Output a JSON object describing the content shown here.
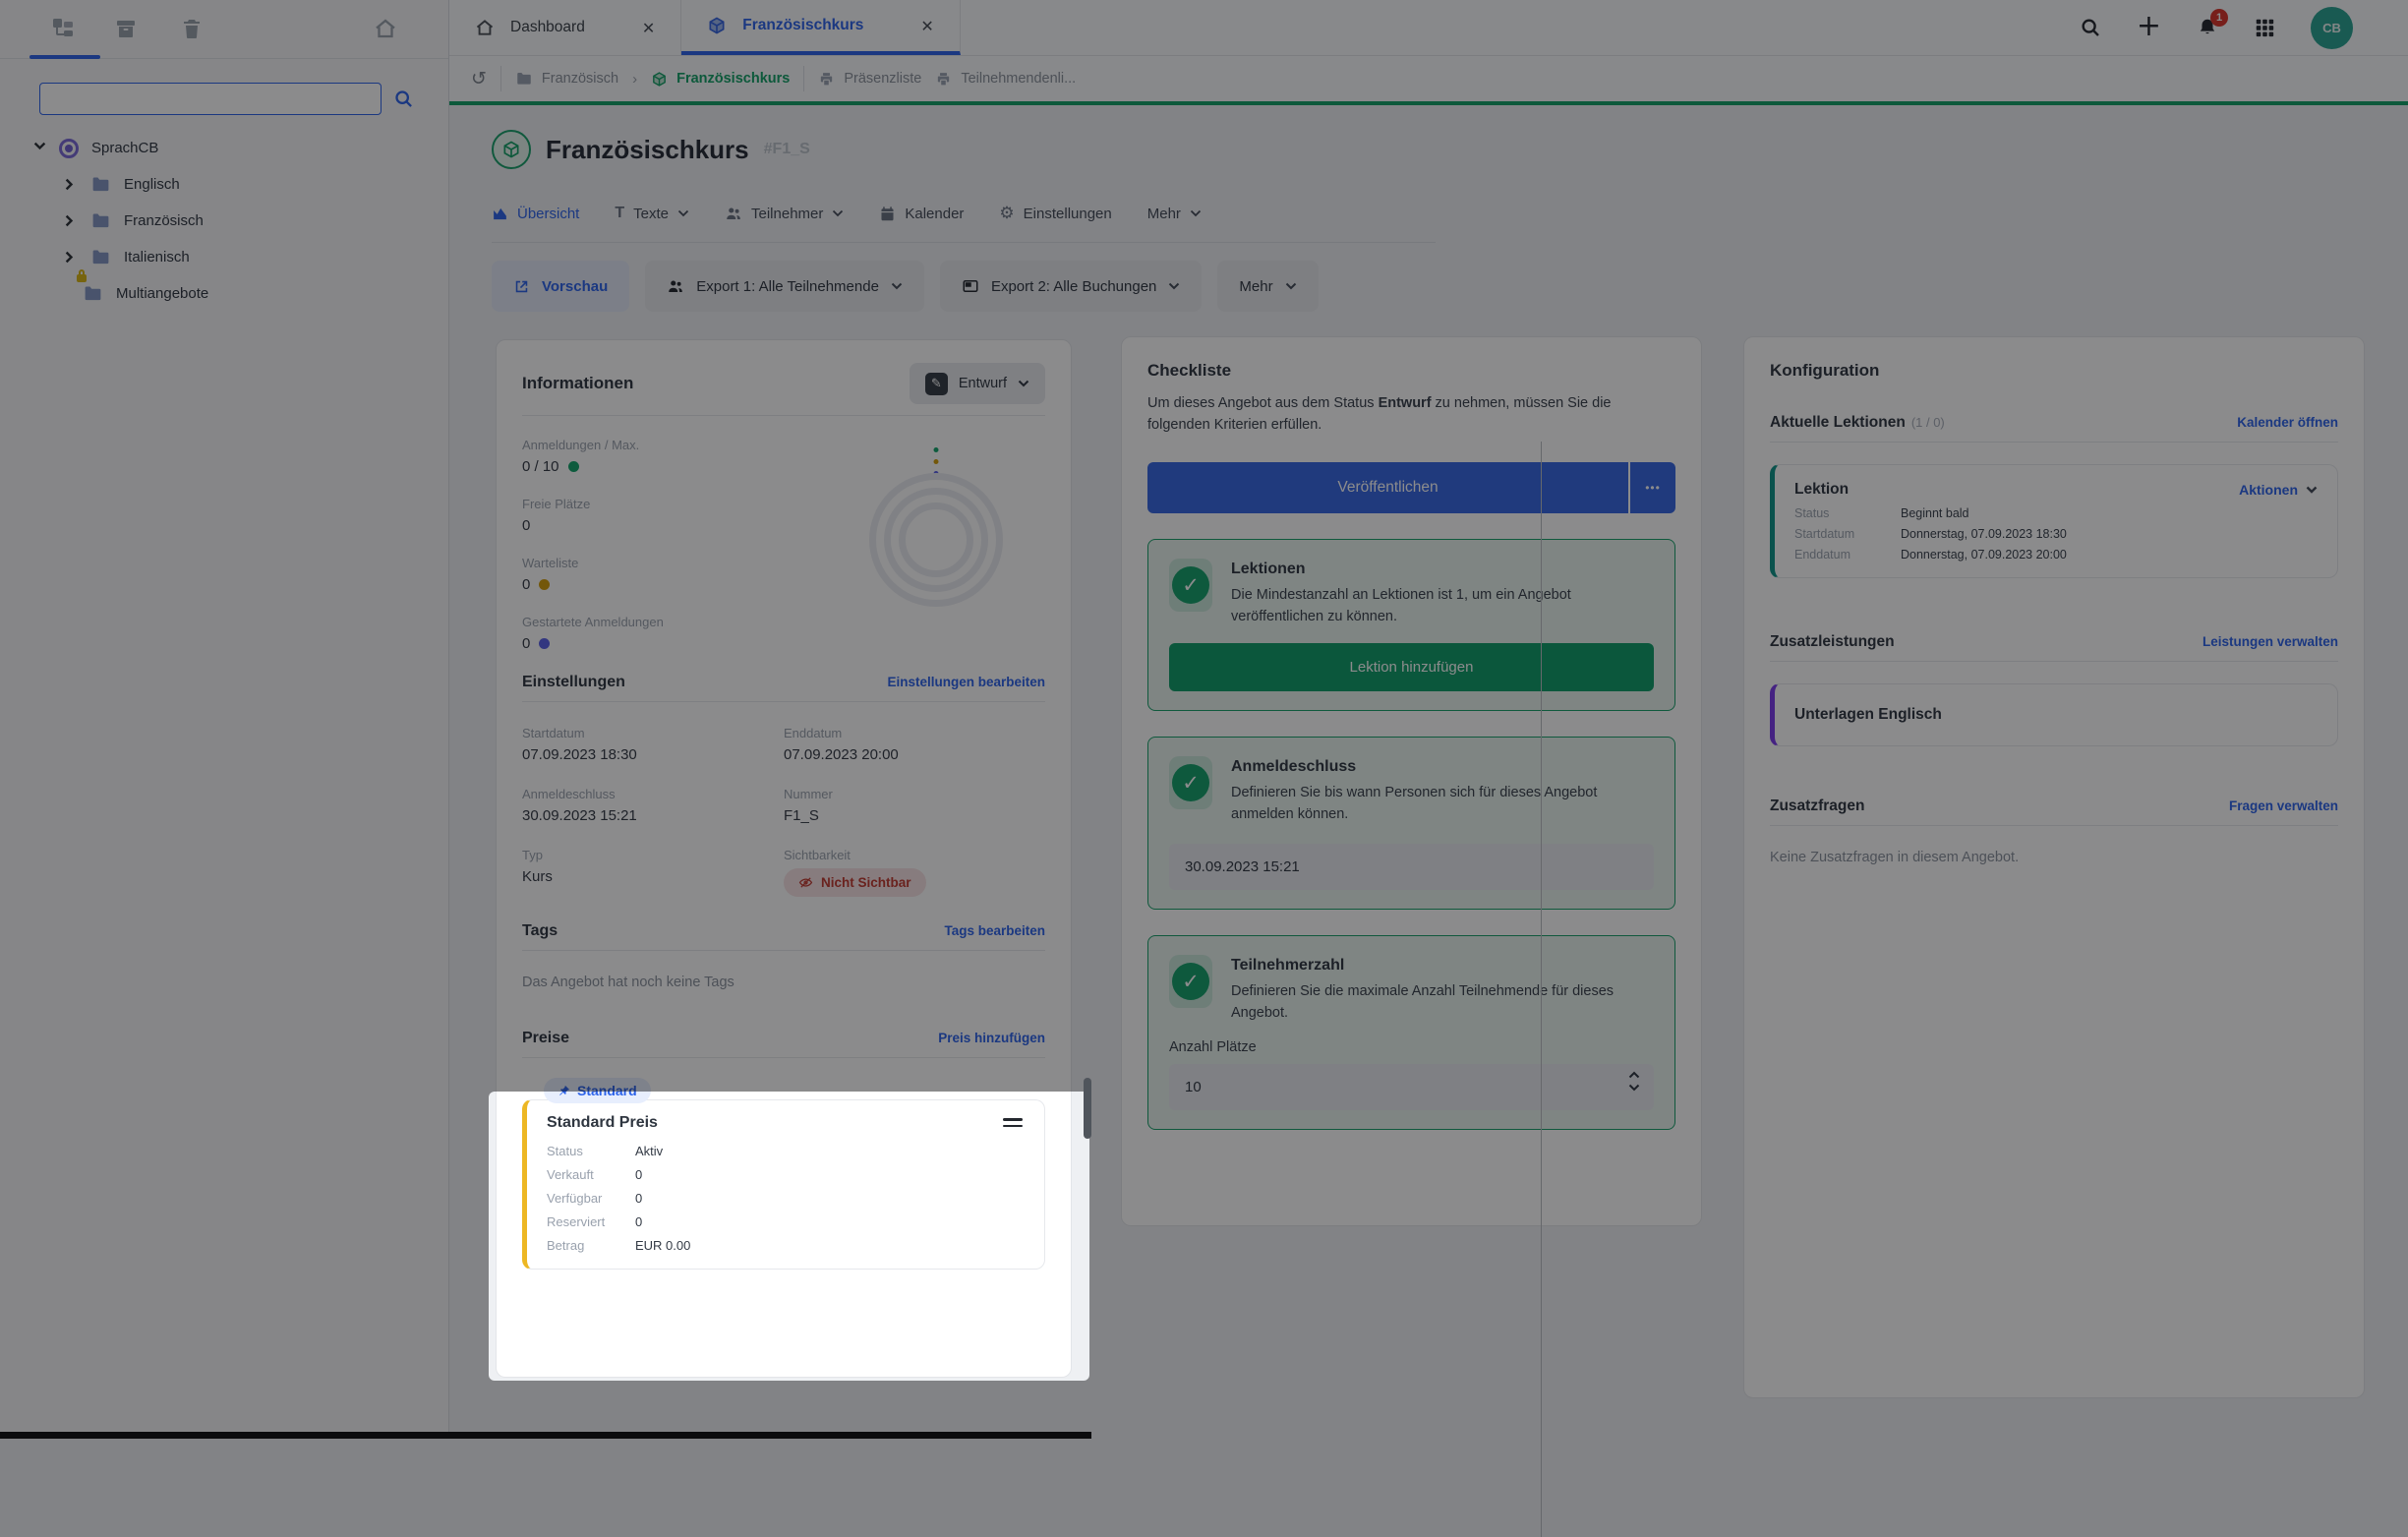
{
  "colors": {
    "accent_blue": "#2c63ea",
    "green": "#12a066",
    "publish_blue": "#3566e3",
    "button_green": "#0f9d68",
    "amber_dot": "#d19e0b",
    "indigo_dot": "#5a60e8",
    "price_yellow": "#edb723",
    "teal_accent": "#0d9488",
    "purple_accent": "#7c3aed",
    "error_red": "#c13a30",
    "notification_red": "#d9342b",
    "avatar_teal": "#28a391"
  },
  "icons": {
    "close": "✕",
    "gear": "⚙",
    "history": "↺",
    "check": "✓",
    "dots": "•••",
    "plus": "+",
    "pencil": "✎",
    "texte": "T"
  },
  "sidebar": {
    "search": {
      "value": ""
    },
    "tree": [
      {
        "label": "SprachCB"
      },
      {
        "label": "Englisch"
      },
      {
        "label": "Französisch"
      },
      {
        "label": "Italienisch"
      },
      {
        "label": "Multiangebote"
      }
    ]
  },
  "tabs": {
    "dashboard": "Dashboard",
    "offer": "Französischkurs"
  },
  "topbar": {
    "notification_count": "1",
    "avatar": "CB"
  },
  "breadcrumb": {
    "folder": "Französisch",
    "offer": "Französischkurs",
    "print1": "Präsenzliste",
    "print2": "Teilnehmendenli..."
  },
  "page": {
    "title": "Französischkurs",
    "number_tag": "#F1_S",
    "nav": {
      "uebersicht": "Übersicht",
      "texte": "Texte",
      "teilnehmer": "Teilnehmer",
      "kalender": "Kalender",
      "einstellungen": "Einstellungen",
      "mehr": "Mehr"
    },
    "actions": {
      "vorschau": "Vorschau",
      "export1": "Export 1: Alle Teilnehmende",
      "export2": "Export 2: Alle Buchungen",
      "mehr": "Mehr"
    }
  },
  "info": {
    "title": "Informationen",
    "status_button": "Entwurf",
    "stats": [
      {
        "label": "Anmeldungen / Max.",
        "value": "0 / 10"
      },
      {
        "label": "Freie Plätze",
        "value": "0"
      },
      {
        "label": "Warteliste",
        "value": "0"
      },
      {
        "label": "Gestartete Anmeldungen",
        "value": "0"
      }
    ],
    "settings": {
      "title": "Einstellungen",
      "edit_link": "Einstellungen bearbeiten",
      "fields": [
        {
          "label": "Startdatum",
          "value": "07.09.2023 18:30"
        },
        {
          "label": "Enddatum",
          "value": "07.09.2023 20:00"
        },
        {
          "label": "Anmeldeschluss",
          "value": "30.09.2023 15:21"
        },
        {
          "label": "Nummer",
          "value": "F1_S"
        },
        {
          "label": "Typ",
          "value": "Kurs"
        },
        {
          "label": "Sichtbarkeit",
          "value": "Nicht Sichtbar"
        }
      ]
    },
    "tags": {
      "title": "Tags",
      "edit_link": "Tags bearbeiten",
      "empty": "Das Angebot hat noch keine Tags"
    },
    "preise": {
      "title": "Preise",
      "add_link": "Preis hinzufügen",
      "badge": "Standard",
      "card": {
        "title": "Standard Preis",
        "rows": [
          {
            "label": "Status",
            "value": "Aktiv"
          },
          {
            "label": "Verkauft",
            "value": "0"
          },
          {
            "label": "Verfügbar",
            "value": "0"
          },
          {
            "label": "Reserviert",
            "value": "0"
          },
          {
            "label": "Betrag",
            "value": "EUR 0.00"
          }
        ]
      }
    }
  },
  "checkliste": {
    "title": "Checkliste",
    "intro_1": "Um dieses Angebot aus dem Status ",
    "intro_bold": "Entwurf",
    "intro_2": " zu nehmen, müssen Sie die folgenden Kriterien erfüllen.",
    "publish": "Veröffentlichen",
    "items": [
      {
        "title": "Lektionen",
        "desc": "Die Mindestanzahl an Lektionen ist 1, um ein Angebot veröffentlichen zu können.",
        "button": "Lektion hinzufügen"
      },
      {
        "title": "Anmeldeschluss",
        "desc": "Definieren Sie bis wann Personen sich für dieses Angebot anmelden können.",
        "input": "30.09.2023 15:21"
      },
      {
        "title": "Teilnehmerzahl",
        "desc": "Definieren Sie die maximale Anzahl Teilnehmende für dieses Angebot.",
        "input_label": "Anzahl Plätze",
        "input": "10"
      }
    ]
  },
  "konfiguration": {
    "title": "Konfiguration",
    "lektionen": {
      "title": "Aktuelle Lektionen",
      "count": "(1 / 0)",
      "link": "Kalender öffnen",
      "card": {
        "title": "Lektion",
        "menu": "Aktionen",
        "rows": [
          {
            "label": "Status",
            "value": "Beginnt bald"
          },
          {
            "label": "Startdatum",
            "value": "Donnerstag, 07.09.2023 18:30"
          },
          {
            "label": "Enddatum",
            "value": "Donnerstag, 07.09.2023 20:00"
          }
        ]
      }
    },
    "zusatzleistungen": {
      "title": "Zusatzleistungen",
      "link": "Leistungen verwalten",
      "item": "Unterlagen Englisch"
    },
    "zusatzfragen": {
      "title": "Zusatzfragen",
      "link": "Fragen verwalten",
      "empty": "Keine Zusatzfragen in diesem Angebot."
    }
  }
}
